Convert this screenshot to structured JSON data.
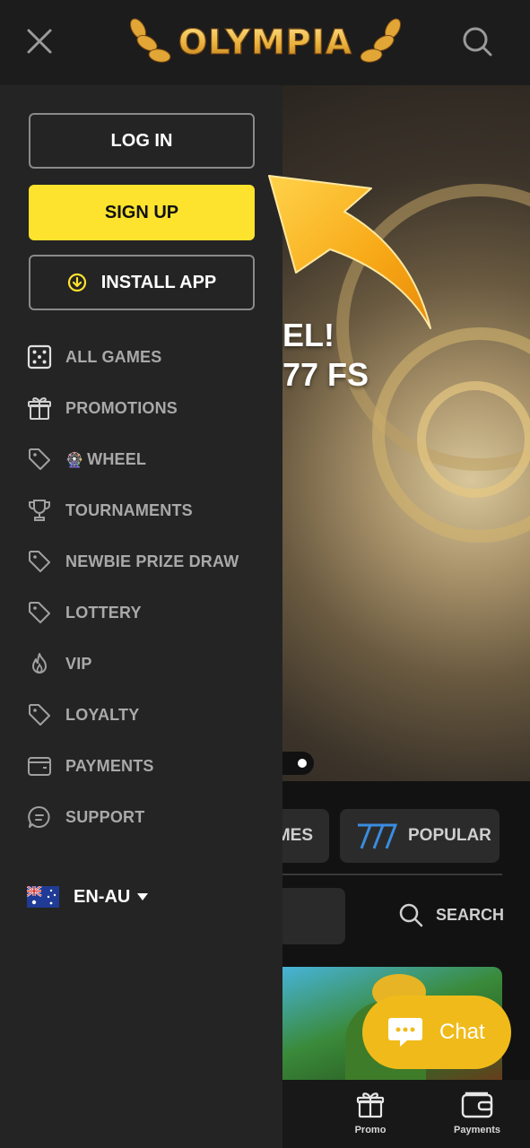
{
  "header": {
    "logo_text": "OLYMPIA"
  },
  "drawer": {
    "login_label": "LOG IN",
    "signup_label": "SIGN UP",
    "install_label": "INSTALL APP",
    "menu": [
      {
        "icon": "dice-icon",
        "label": "ALL GAMES"
      },
      {
        "icon": "gift-icon",
        "label": "PROMOTIONS"
      },
      {
        "icon": "tag-icon",
        "label": "WHEEL",
        "prefix": "🎡"
      },
      {
        "icon": "trophy-icon",
        "label": "TOURNAMENTS"
      },
      {
        "icon": "tag-icon",
        "label": "NEWBIE PRIZE DRAW"
      },
      {
        "icon": "tag-icon",
        "label": "LOTTERY"
      },
      {
        "icon": "flame-icon",
        "label": "VIP"
      },
      {
        "icon": "tag-icon",
        "label": "LOYALTY"
      },
      {
        "icon": "wallet-icon",
        "label": "PAYMENTS"
      },
      {
        "icon": "chat-bubble-icon",
        "label": "SUPPORT"
      }
    ],
    "language": "EN-AU"
  },
  "background": {
    "banner_line1": "EL!",
    "banner_line2": "77 FS",
    "tab_partial": "MES",
    "tab_popular": "POPULAR",
    "search_label": "SEARCH"
  },
  "bottom_nav": {
    "promo": "Promo",
    "payments": "Payments"
  },
  "chat": {
    "label": "Chat"
  },
  "colors": {
    "accent_yellow": "#fde32d",
    "chat_yellow": "#f0bb1a",
    "drawer_bg": "#242424",
    "arrow_orange": "#f7a816"
  }
}
